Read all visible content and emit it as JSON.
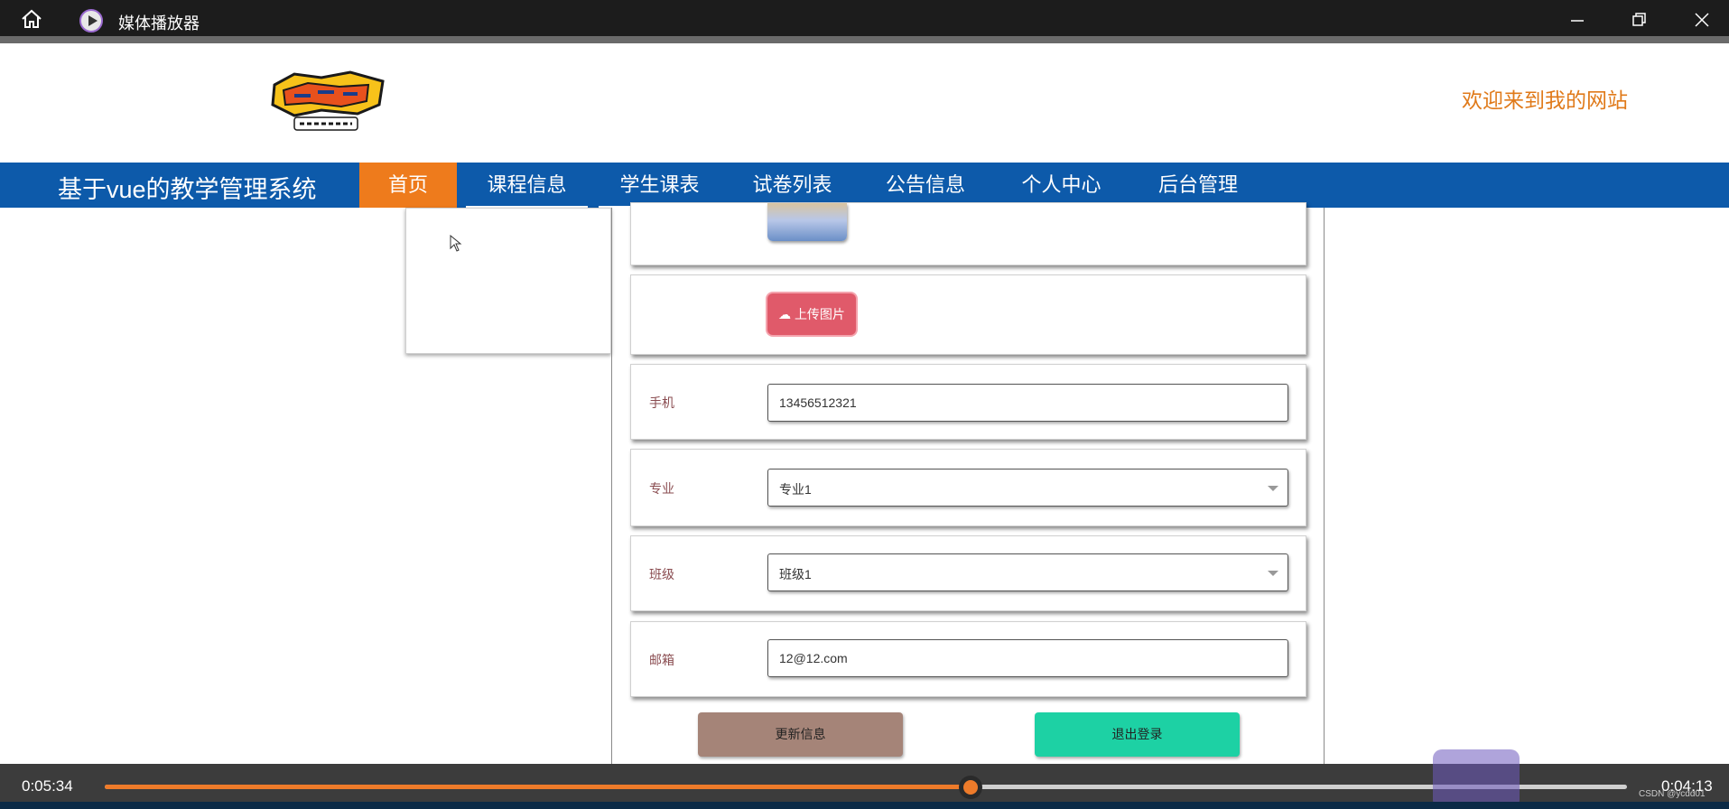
{
  "window": {
    "title": "媒体播放器"
  },
  "header": {
    "welcome": "欢迎来到我的网站"
  },
  "nav": {
    "brand": "基于vue的教学管理系统",
    "items": [
      {
        "label": "首页",
        "active": true
      },
      {
        "label": "课程信息",
        "active": false
      },
      {
        "label": "学生课表",
        "active": false
      },
      {
        "label": "试卷列表",
        "active": false
      },
      {
        "label": "公告信息",
        "active": false
      },
      {
        "label": "个人中心",
        "active": false
      },
      {
        "label": "后台管理",
        "active": false
      }
    ]
  },
  "form": {
    "upload_label": "上传图片",
    "phone_label": "手机",
    "phone_value": "13456512321",
    "major_label": "专业",
    "major_value": "专业1",
    "class_label": "班级",
    "class_value": "班级1",
    "email_label": "邮箱",
    "email_value": "12@12.com",
    "update_button": "更新信息",
    "logout_button": "退出登录"
  },
  "player": {
    "elapsed": "0:05:34",
    "remaining": "0:04:13",
    "progress": 0.569
  },
  "watermark": "CSDN @ycdd01",
  "colors": {
    "nav_bg": "#0d5aaa",
    "nav_active": "#ee7b1c",
    "welcome_text": "#e07a1a",
    "upload_button": "#e05a6a",
    "update_button": "#a58478",
    "logout_button": "#1dd1a4",
    "progress_fill": "#ee7b2a"
  }
}
